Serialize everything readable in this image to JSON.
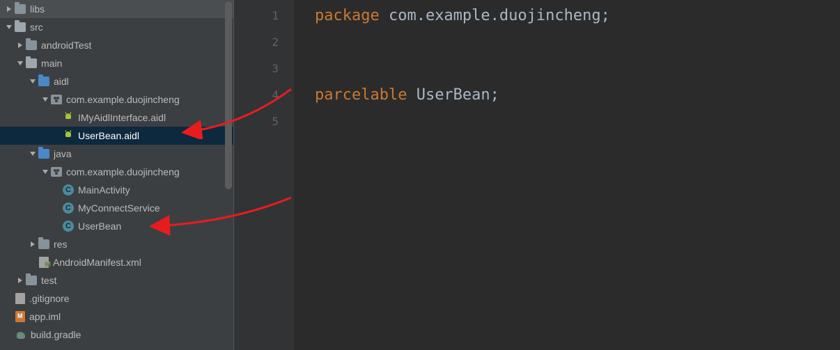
{
  "tree": {
    "libs": "libs",
    "src": "src",
    "androidTest": "androidTest",
    "main": "main",
    "aidl": "aidl",
    "aidlPkg": "com.example.duojincheng",
    "aidlFile1": "IMyAidlInterface.aidl",
    "aidlFile2": "UserBean.aidl",
    "java": "java",
    "javaPkg": "com.example.duojincheng",
    "class1": "MainActivity",
    "class2": "MyConnectService",
    "class3": "UserBean",
    "res": "res",
    "manifest": "AndroidManifest.xml",
    "test": "test",
    "gitignore": ".gitignore",
    "appIml": "app.iml",
    "buildGradle": "build.gradle"
  },
  "gutter": {
    "l1": "1",
    "l2": "2",
    "l3": "3",
    "l4": "4",
    "l5": "5"
  },
  "code": {
    "kwPackage": "package",
    "pkgName": " com.example.duojincheng;",
    "kwParcelable": "parcelable",
    "parcelName": " UserBean;"
  }
}
